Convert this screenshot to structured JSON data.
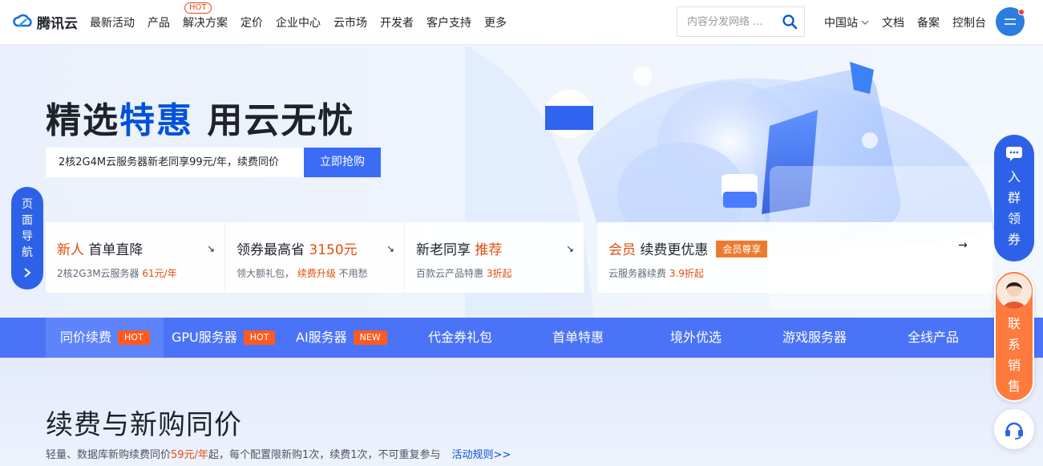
{
  "header": {
    "logo_text": "腾讯云",
    "nav": [
      {
        "label": "最新活动"
      },
      {
        "label": "产品",
        "tag": "HOT"
      },
      {
        "label": "解决方案"
      },
      {
        "label": "定价"
      },
      {
        "label": "企业中心"
      },
      {
        "label": "云市场"
      },
      {
        "label": "开发者"
      },
      {
        "label": "客户支持"
      },
      {
        "label": "更多"
      }
    ],
    "search_placeholder": "内容分发网络 ...",
    "right_nav": [
      "中国站",
      "文档",
      "备案",
      "控制台"
    ]
  },
  "hero": {
    "title_part1": "精选",
    "title_accent": "特惠",
    "title_part2": " 用云无忧",
    "promo_text": "2核2G4M云服务器新老同享99元/年，续费同价",
    "promo_button": "立即抢购",
    "side_tab": "页面导航",
    "cards": [
      {
        "title_orange": "新人",
        "title": " 首单直降",
        "desc": "2核2G3M云服务器 ",
        "desc_orange": "61元/年",
        "desc_tail": ""
      },
      {
        "title": "领券最高省 ",
        "title_orange": "3150元",
        "desc": "领大额礼包， ",
        "desc_orange": "续费升级",
        "desc_tail": " 不用愁"
      },
      {
        "title": "新老同享 ",
        "title_orange": "推荐",
        "desc": "百款云产品特惠 ",
        "desc_orange": "3折起",
        "desc_tail": ""
      },
      {
        "title_orange": "会员",
        "title": " 续费更优惠",
        "badge": "会员尊享",
        "desc": "云服务器续费 ",
        "desc_orange": "3.9折起",
        "desc_tail": ""
      }
    ]
  },
  "categories": [
    {
      "label": "同价续费",
      "badge": "HOT"
    },
    {
      "label": "GPU服务器",
      "badge": "HOT"
    },
    {
      "label": "AI服务器",
      "badge": "NEW"
    },
    {
      "label": "代金券礼包"
    },
    {
      "label": "首单特惠"
    },
    {
      "label": "境外优选"
    },
    {
      "label": "游戏服务器"
    },
    {
      "label": "全线产品"
    }
  ],
  "section": {
    "title": "续费与新购同价",
    "sub_part1": "轻量、数据库新购续费同价",
    "sub_orange": "59元/年",
    "sub_part2": "起，每个配置限新购1次，续费1次，不可重复参与",
    "rules_link": "活动规则>>"
  },
  "floating": {
    "group": "入群领券",
    "sales": "联系销售"
  },
  "colors": {
    "brand": "#0052d9",
    "category_bar": "#4b73f7",
    "accent_orange": "#e54d0e"
  }
}
